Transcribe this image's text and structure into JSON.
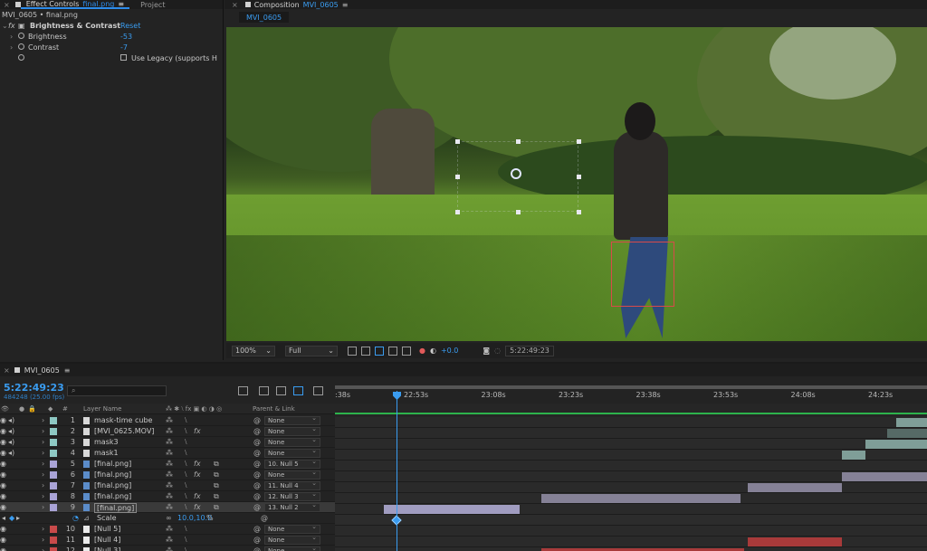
{
  "effect_controls": {
    "tabs": [
      {
        "label": "Effect Controls",
        "target": "final.png",
        "active": true
      },
      {
        "label": "Project",
        "active": false
      }
    ],
    "subtitle": "MVI_0605 • final.png",
    "effect": {
      "name": "Brightness & Contrast",
      "reset_label": "Reset"
    },
    "props": [
      {
        "label": "Brightness",
        "value": "-53"
      },
      {
        "label": "Contrast",
        "value": "-7"
      }
    ],
    "legacy_label": "Use Legacy (supports H"
  },
  "composition": {
    "tab_label": "Composition",
    "comp_name": "MVI_0605",
    "subtab": "MVI_0605",
    "toolbar": {
      "zoom": "100%",
      "resolution": "Full",
      "exposure": "+0.0",
      "timecode": "5:22:49:23"
    }
  },
  "timeline": {
    "tab_label": "MVI_0605",
    "timecode": "5:22:49:23",
    "fps": "484248 (25.00 fps)",
    "search_placeholder": "",
    "columns": {
      "num": "#",
      "layer_name": "Layer Name",
      "parent": "Parent & Link"
    },
    "ruler_labels": [
      ":38s",
      "22:53s",
      "23:08s",
      "23:23s",
      "23:38s",
      "23:53s",
      "24:08s",
      "24:23s"
    ],
    "layers": [
      {
        "num": "1",
        "name": "mask-time cube",
        "color": "#8ec9c4",
        "type": "comp",
        "fx": false,
        "parent": "None"
      },
      {
        "num": "2",
        "name": "[MVI_0625.MOV]",
        "color": "#8ec9c4",
        "type": "comp",
        "fx": true,
        "parent": "None"
      },
      {
        "num": "3",
        "name": "mask3",
        "color": "#8ec9c4",
        "type": "comp",
        "fx": false,
        "parent": "None"
      },
      {
        "num": "4",
        "name": "mask1",
        "color": "#8ec9c4",
        "type": "comp",
        "fx": false,
        "parent": "None"
      },
      {
        "num": "5",
        "name": "[final.png]",
        "color": "#a9a3d6",
        "type": "img",
        "fx": true,
        "parent": "10. Null 5"
      },
      {
        "num": "6",
        "name": "[final.png]",
        "color": "#a9a3d6",
        "type": "img",
        "fx": true,
        "parent": "None"
      },
      {
        "num": "7",
        "name": "[final.png]",
        "color": "#a9a3d6",
        "type": "img",
        "fx": false,
        "parent": "11. Null 4"
      },
      {
        "num": "8",
        "name": "[final.png]",
        "color": "#a9a3d6",
        "type": "img",
        "fx": true,
        "parent": "12. Null 3"
      },
      {
        "num": "9",
        "name": "[final.png]",
        "color": "#a9a3d6",
        "type": "img",
        "fx": true,
        "parent": "13. Null 2"
      },
      {
        "num": "10",
        "name": "[Null 5]",
        "color": "#c84a4a",
        "type": "null",
        "fx": false,
        "parent": "None"
      },
      {
        "num": "11",
        "name": "[Null 4]",
        "color": "#c84a4a",
        "type": "null",
        "fx": false,
        "parent": "None"
      },
      {
        "num": "12",
        "name": "[Null 3]",
        "color": "#c84a4a",
        "type": "null",
        "fx": false,
        "parent": "None"
      }
    ],
    "scale_row": {
      "label": "Scale",
      "value": "10.0,10.0",
      "unit": "%"
    }
  }
}
